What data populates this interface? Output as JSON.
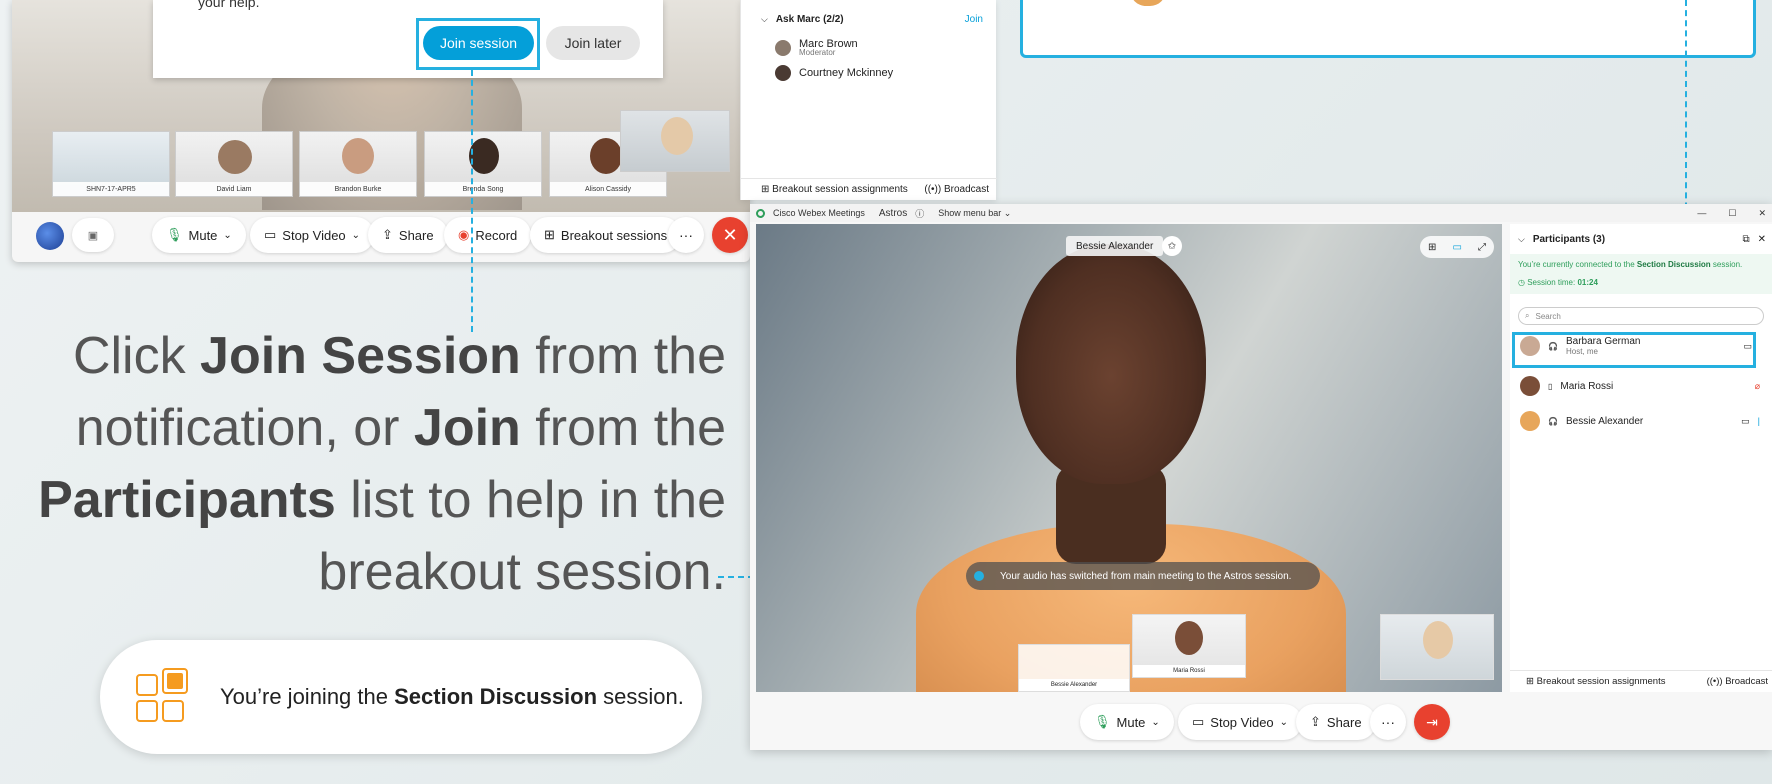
{
  "top_left_window": {
    "notification_text": "your help.",
    "join_session_label": "Join session",
    "join_later_label": "Join later",
    "thumbnails": [
      {
        "name": "SHN7-17-APR5"
      },
      {
        "name": "David Liam"
      },
      {
        "name": "Brandon Burke"
      },
      {
        "name": "Brenda Song"
      },
      {
        "name": "Alison Cassidy"
      }
    ],
    "toolbar": {
      "mute": "Mute",
      "stop_video": "Stop Video",
      "share": "Share",
      "record": "Record",
      "breakout": "Breakout sessions",
      "more": "···"
    }
  },
  "top_middle_panel": {
    "group_label": "Ask Marc (2/2)",
    "join_link": "Join",
    "members": [
      {
        "name": "Marc Brown",
        "role": "Moderator"
      },
      {
        "name": "Courtney Mckinney",
        "role": ""
      }
    ],
    "assignments_label": "Breakout session assignments",
    "broadcast_label": "Broadcast"
  },
  "caption": {
    "line1_a": "Click ",
    "line1_b": "Join Session",
    "line1_c": " from the",
    "line2_a": "notification, or ",
    "line2_b": "Join",
    "line2_c": " from the",
    "line3_a": "Participants",
    "line3_b": " list to help in the",
    "line4": "breakout session."
  },
  "toast": {
    "text_a": "You’re joining the ",
    "text_b": "Section Discussion",
    "text_c": " session."
  },
  "main_window": {
    "app_name": "Cisco Webex Meetings",
    "session_name": "Astros",
    "show_menu": "Show menu bar",
    "speaker_label": "Bessie Alexander",
    "audio_notice": "Your audio has switched from main meeting to the Astros session.",
    "thumb1_name": "Bessie Alexander",
    "thumb2_name": "Maria Rossi",
    "toolbar": {
      "mute": "Mute",
      "stop_video": "Stop Video",
      "share": "Share",
      "more": "···"
    }
  },
  "participants_panel": {
    "title": "Participants (3)",
    "connected_a": "You’re currently connected to the ",
    "connected_b": "Section Discussion",
    "connected_c": " session.",
    "session_time_label": "Session time: ",
    "session_time_value": "01:24",
    "search_placeholder": "Search",
    "participants": [
      {
        "name": "Barbara German",
        "sub": "Host, me"
      },
      {
        "name": "Maria Rossi",
        "sub": ""
      },
      {
        "name": "Bessie Alexander",
        "sub": ""
      }
    ],
    "assignments_label": "Breakout session assignments",
    "broadcast_label": "Broadcast"
  },
  "colors": {
    "accent_blue": "#25b0e0",
    "join_blue": "#049fd9",
    "end_red": "#e8412f",
    "green": "#2e9e5b"
  }
}
